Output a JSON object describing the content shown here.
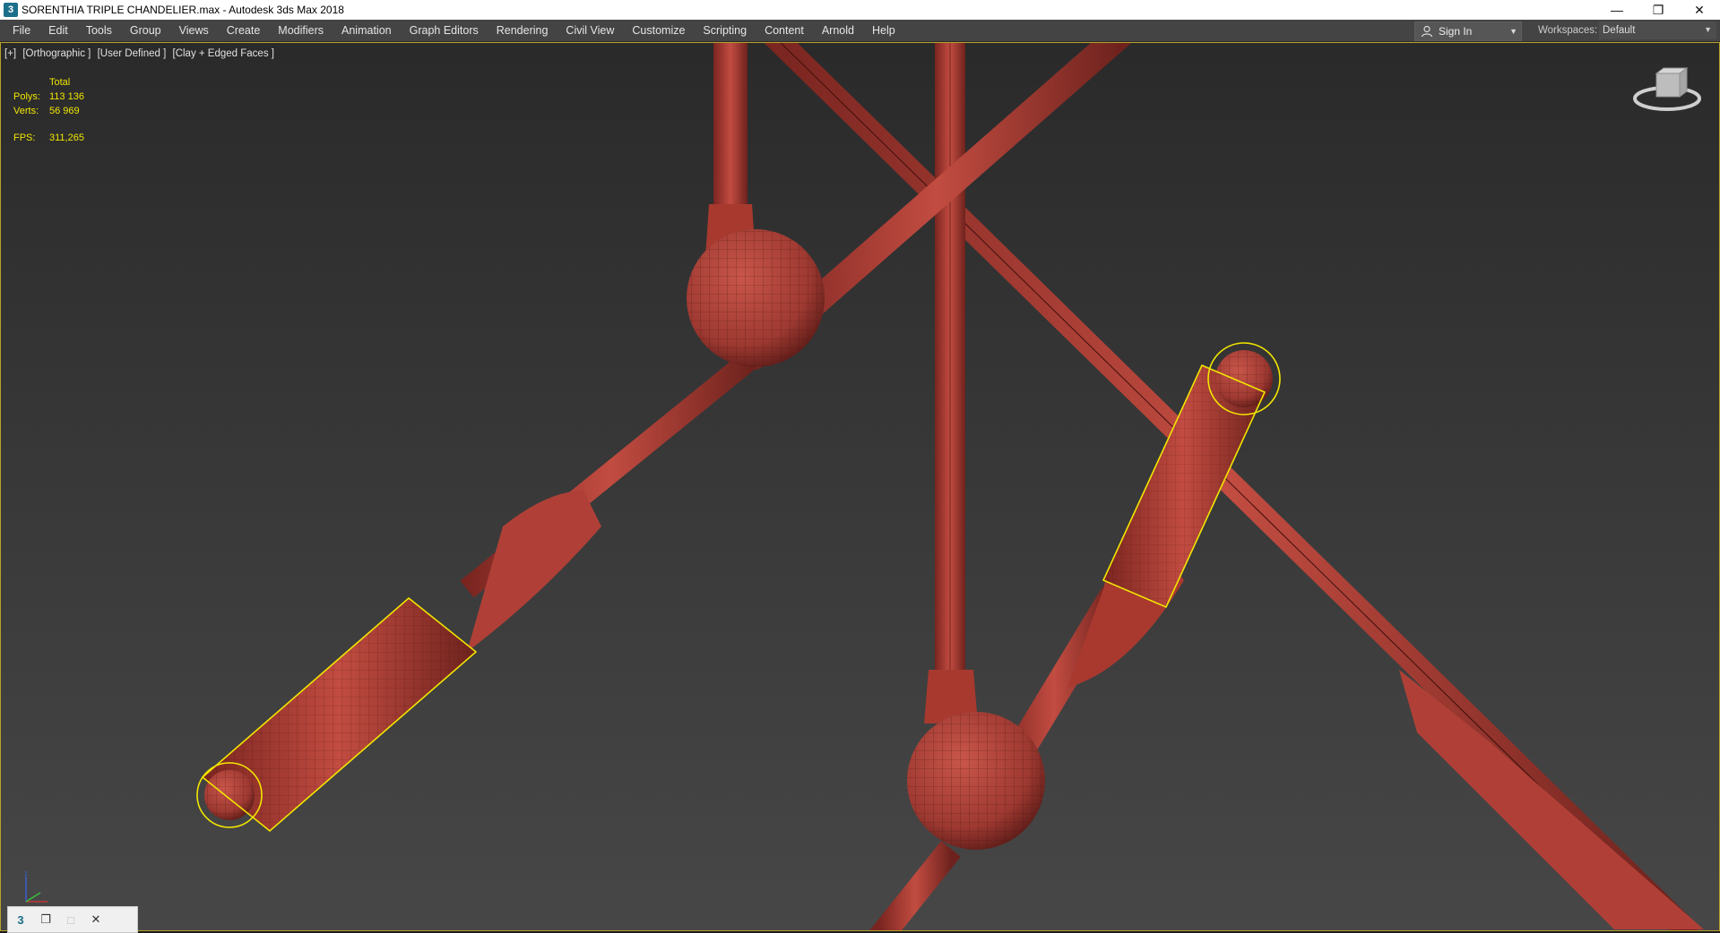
{
  "window": {
    "title": "SORENTHIA TRIPLE CHANDELIER.max - Autodesk 3ds Max 2018",
    "app_icon_glyph": "3",
    "controls": {
      "minimize": "—",
      "restore": "❐",
      "close": "✕"
    }
  },
  "menubar": {
    "items": [
      "File",
      "Edit",
      "Tools",
      "Group",
      "Views",
      "Create",
      "Modifiers",
      "Animation",
      "Graph Editors",
      "Rendering",
      "Civil View",
      "Customize",
      "Scripting",
      "Content",
      "Arnold",
      "Help"
    ],
    "sign_in": "Sign In",
    "workspaces_label": "Workspaces:",
    "workspaces_value": "Default"
  },
  "viewport": {
    "labels": [
      "[+]",
      "[Orthographic ]",
      "[User Defined ]",
      "[Clay + Edged Faces ]"
    ],
    "stats": {
      "header": "Total",
      "polys_label": "Polys:",
      "polys_value": "113 136",
      "verts_label": "Verts:",
      "verts_value": "56 969",
      "fps_label": "FPS:",
      "fps_value": "311,265"
    },
    "axis_label": "z",
    "accent_color": "#b8a12a",
    "model_color": "#b5433a",
    "selection_color": "#f2e600"
  },
  "bottom_panel": {
    "icons": [
      "3ds-max-icon",
      "restore-icon",
      "maximize-icon",
      "close-icon"
    ],
    "glyphs": [
      "3",
      "❐",
      "□",
      "✕"
    ]
  }
}
